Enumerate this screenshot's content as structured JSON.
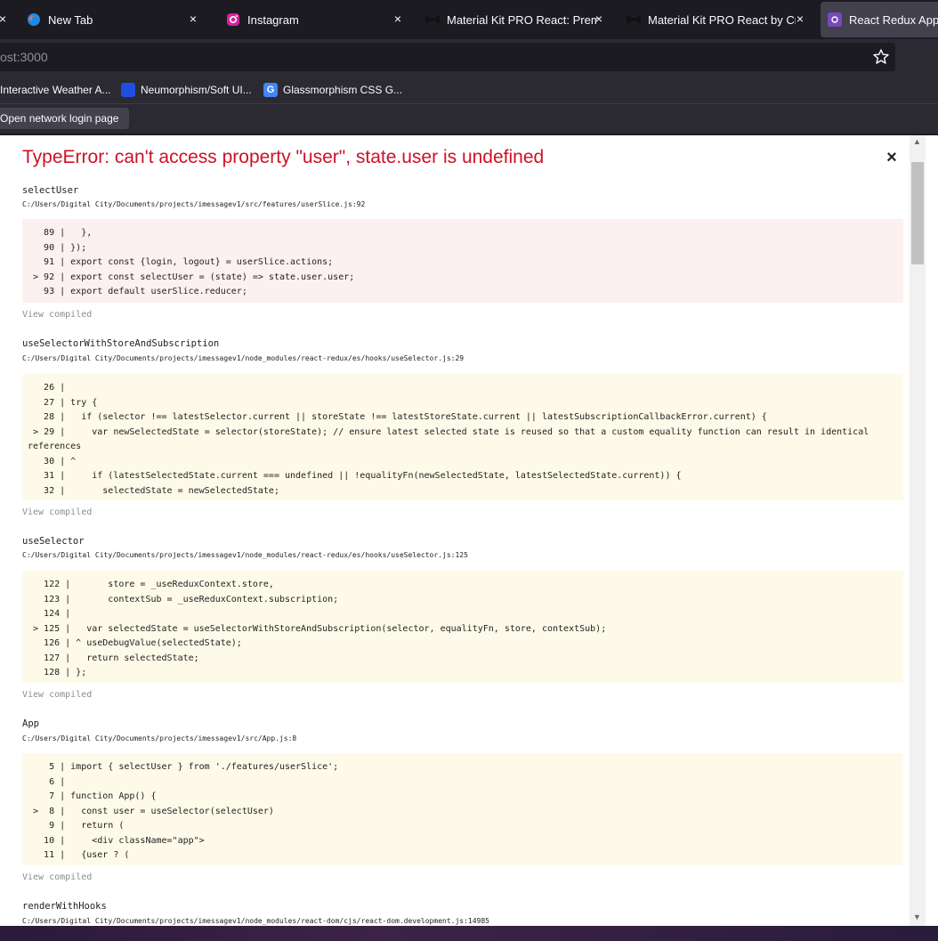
{
  "tabs": [
    {
      "title": "New Tab",
      "icon": "firefox-icon"
    },
    {
      "title": "Instagram",
      "icon": "instagram-icon"
    },
    {
      "title": "Material Kit PRO React: Premium",
      "icon": "creative-tim-icon"
    },
    {
      "title": "Material Kit PRO React by Creati",
      "icon": "creative-tim-icon"
    },
    {
      "title": "React Redux App",
      "icon": "react-redux-icon",
      "active": true
    }
  ],
  "tab_close": "×",
  "address": {
    "host_dim": "ost",
    "rest": ":3000"
  },
  "bookmarks": [
    {
      "label": "Interactive Weather A...",
      "icon": "page-icon"
    },
    {
      "label": "Neumorphism/Soft UI...",
      "icon": "neumorphism-icon"
    },
    {
      "label": "Glassmorphism CSS G...",
      "icon": "g-icon",
      "letter": "G"
    }
  ],
  "notification": {
    "button": "Open network login page"
  },
  "overlay": {
    "title": "TypeError: can't access property \"user\", state.user is undefined",
    "close": "×",
    "view_compiled": "View compiled",
    "frames": [
      {
        "fn": "selectUser",
        "path": "C:/Users/Digital City/Documents/projects/imessagev1/src/features/userSlice.js:92",
        "kind": "err",
        "lines": [
          "   89 |   },",
          "   90 | });",
          "   91 | export const {login, logout} = userSlice.actions;",
          " > 92 | export const selectUser = (state) => state.user.user;",
          "   93 | export default userSlice.reducer;"
        ]
      },
      {
        "fn": "useSelectorWithStoreAndSubscription",
        "path": "C:/Users/Digital City/Documents/projects/imessagev1/node_modules/react-redux/es/hooks/useSelector.js:29",
        "kind": "warn",
        "lines": [
          "   26 | ",
          "   27 | try {",
          "   28 |   if (selector !== latestSelector.current || storeState !== latestStoreState.current || latestSubscriptionCallbackError.current) {",
          " > 29 |     var newSelectedState = selector(storeState); // ensure latest selected state is reused so that a custom equality function can result in identical references",
          "   30 | ^",
          "   31 |     if (latestSelectedState.current === undefined || !equalityFn(newSelectedState, latestSelectedState.current)) {",
          "   32 |       selectedState = newSelectedState;"
        ]
      },
      {
        "fn": "useSelector",
        "path": "C:/Users/Digital City/Documents/projects/imessagev1/node_modules/react-redux/es/hooks/useSelector.js:125",
        "kind": "warn",
        "lines": [
          "   122 |       store = _useReduxContext.store,",
          "   123 |       contextSub = _useReduxContext.subscription;",
          "   124 | ",
          " > 125 |   var selectedState = useSelectorWithStoreAndSubscription(selector, equalityFn, store, contextSub);",
          "   126 | ^ useDebugValue(selectedState);",
          "   127 |   return selectedState;",
          "   128 | };"
        ]
      },
      {
        "fn": "App",
        "path": "C:/Users/Digital City/Documents/projects/imessagev1/src/App.js:8",
        "kind": "warn",
        "lines": [
          "    5 | import { selectUser } from './features/userSlice';",
          "    6 | ",
          "    7 | function App() {",
          " >  8 |   const user = useSelector(selectUser)",
          "    9 |   return (",
          "   10 |     <div className=\"app\">",
          "   11 |   {user ? ("
        ]
      },
      {
        "fn": "renderWithHooks",
        "path": "C:/Users/Digital City/Documents/projects/imessagev1/node_modules/react-dom/cjs/react-dom.development.js:14985",
        "kind": "none",
        "lines": []
      }
    ]
  }
}
